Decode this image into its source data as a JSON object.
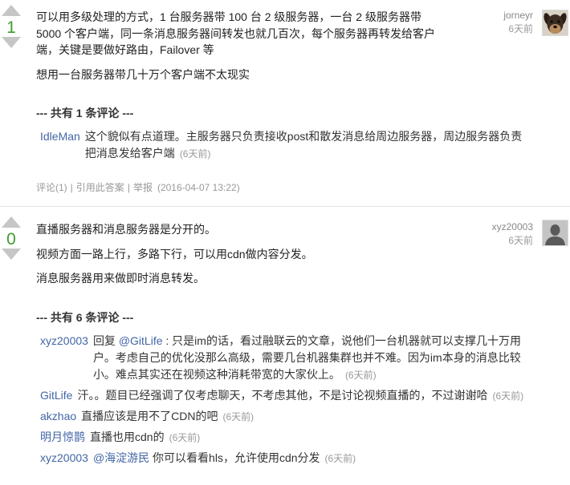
{
  "theme": {
    "vote_color": "#3f9b2f",
    "link_color": "#4366a6",
    "muted_color": "#999999",
    "arrow_color": "#c6c6c6"
  },
  "icons": {
    "vote_up": "up-arrow-icon",
    "vote_down": "down-arrow-icon",
    "avatar_1": "dog-photo-avatar",
    "avatar_2": "person-silhouette-icon"
  },
  "answers": [
    {
      "votes": "1",
      "author": "jorneyr",
      "time": "6天前",
      "paragraphs": [
        "可以用多级处理的方式，1 台服务器带 100 台 2 级服务器，一台 2 级服务器带 5000 个客户端，同一条消息服务器间转发也就几百次，每个服务器再转发给客户端，关键是要做好路由，Failover 等",
        "想用一台服务器带几十万个客户端不太现实"
      ],
      "comment_header": "--- 共有 1 条评论 ---",
      "comments": [
        {
          "author": "IdleMan",
          "text": "这个貌似有点道理。主服务器只负责接收post和散发消息给周边服务器，周边服务器负责把消息发给客户端",
          "time": "(6天前)"
        }
      ],
      "footer": {
        "comment_link": "评论(1)",
        "separator": "|",
        "quote_link": "引用此答案",
        "report_link": "举报",
        "date": "(2016-04-07 13:22)"
      }
    },
    {
      "votes": "0",
      "author": "xyz20003",
      "time": "6天前",
      "paragraphs": [
        "直播服务器和消息服务器是分开的。",
        "视频方面一路上行，多路下行，可以用cdn做内容分发。",
        "消息服务器用来做即时消息转发。"
      ],
      "comment_header": "--- 共有 6 条评论 ---",
      "comments": [
        {
          "author": "xyz20003",
          "prefix": "回复 ",
          "mention": "@GitLife",
          "text": " : 只是im的话，看过融联云的文章，说他们一台机器就可以支撑几十万用户。考虑自己的优化没那么高级，需要几台机器集群也并不难。因为im本身的消息比较小。难点其实还在视频这种消耗带宽的大家伙上。",
          "time": "(6天前)"
        },
        {
          "author": "GitLife",
          "text": "汗。。题目已经强调了仅考虑聊天，不考虑其他，不是讨论视频直播的，不过谢谢哈",
          "time": "(6天前)"
        },
        {
          "author": "akzhao",
          "text": "直播应该是用不了CDN的吧",
          "time": "(6天前)"
        },
        {
          "author": "明月惊鹊",
          "text": "直播也用cdn的",
          "time": "(6天前)"
        },
        {
          "author": "xyz20003",
          "mention": "@海淀游民",
          "text": " 你可以看看hls，允许使用cdn分发",
          "time": "(6天前)"
        }
      ]
    }
  ]
}
